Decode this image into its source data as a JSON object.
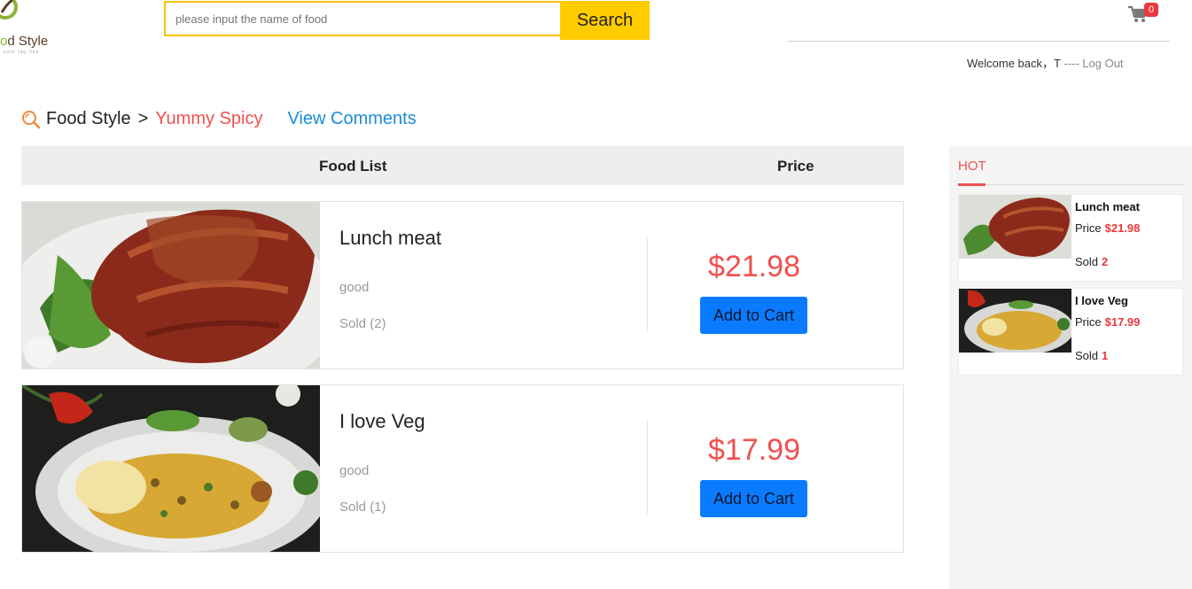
{
  "header": {
    "logo_text_prefix": "o",
    "logo_text": "d Style",
    "logo_tagline": "your tag line",
    "search": {
      "placeholder": "please input the name of food",
      "button_label": "Search"
    },
    "cart_count": "0",
    "welcome_text": "Welcome back，T",
    "separator": " ---- ",
    "logout_label": "Log Out"
  },
  "breadcrumb": {
    "root": "Food Style",
    "separator": ">",
    "category": "Yummy Spicy",
    "comments_link": "View Comments"
  },
  "list": {
    "header_food": "Food List",
    "header_price": "Price",
    "items": [
      {
        "name": "Lunch meat",
        "desc": "good",
        "sold": "Sold (2)",
        "price": "$21.98",
        "button": "Add to Cart"
      },
      {
        "name": "I love Veg",
        "desc": "good",
        "sold": "Sold (1)",
        "price": "$17.99",
        "button": "Add to Cart"
      }
    ]
  },
  "hot": {
    "title": "HOT",
    "price_label": "Price",
    "sold_label": "Sold",
    "items": [
      {
        "name": "Lunch meat",
        "price": "$21.98",
        "sold": "2"
      },
      {
        "name": "I love Veg",
        "price": "$17.99",
        "sold": "1"
      }
    ]
  },
  "colors": {
    "accent_red": "#f0504f",
    "search_yellow": "#ffcc00",
    "button_blue": "#0a7bff",
    "link_blue": "#1a8cd8"
  },
  "icons": [
    "logo-icon",
    "cart-icon",
    "search-magnifier-icon"
  ]
}
